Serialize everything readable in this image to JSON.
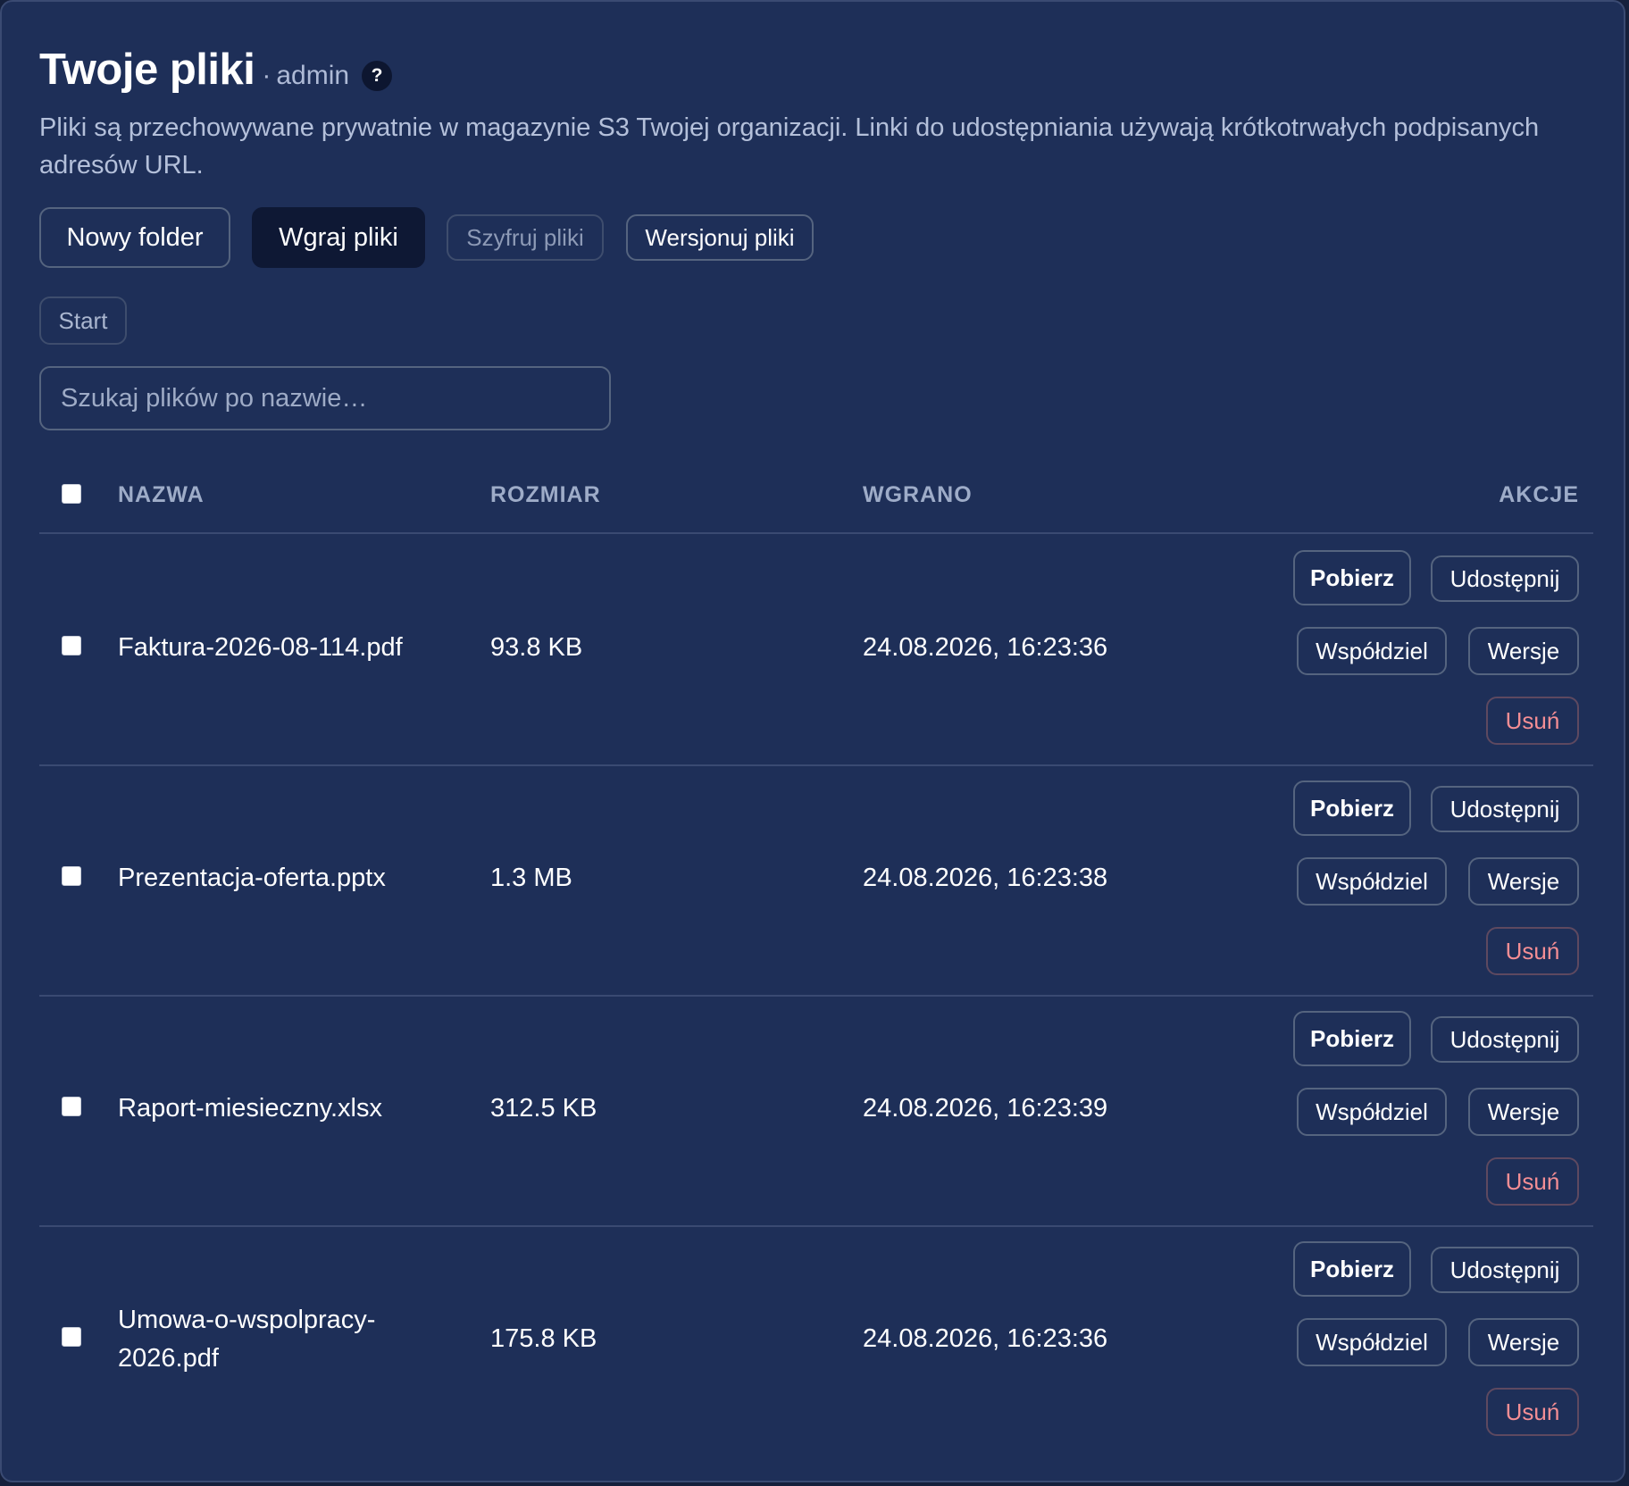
{
  "header": {
    "title": "Twoje pliki",
    "separator": "·",
    "user": "admin",
    "help_label": "?",
    "description": "Pliki są przechowywane prywatnie w magazynie S3 Twojej organizacji. Linki do udostępniania używają krótkotrwałych podpisanych adresów URL."
  },
  "toolbar": {
    "new_folder": "Nowy folder",
    "upload": "Wgraj pliki",
    "encrypt": "Szyfruj pliki",
    "version": "Wersjonuj pliki"
  },
  "breadcrumb": {
    "root": "Start"
  },
  "search": {
    "placeholder": "Szukaj plików po nazwie…",
    "value": ""
  },
  "table": {
    "headers": {
      "name": "NAZWA",
      "size": "ROZMIAR",
      "uploaded": "WGRANO",
      "actions": "AKCJE"
    },
    "actions": {
      "download": "Pobierz",
      "share": "Udostępnij",
      "coshare": "Współdziel",
      "versions": "Wersje",
      "delete": "Usuń"
    },
    "rows": [
      {
        "name": "Faktura-2026-08-114.pdf",
        "size": "93.8 KB",
        "uploaded": "24.08.2026, 16:23:36"
      },
      {
        "name": "Prezentacja-oferta.pptx",
        "size": "1.3 MB",
        "uploaded": "24.08.2026, 16:23:38"
      },
      {
        "name": "Raport-miesieczny.xlsx",
        "size": "312.5 KB",
        "uploaded": "24.08.2026, 16:23:39"
      },
      {
        "name": "Umowa-o-wspolpracy-2026.pdf",
        "size": "175.8 KB",
        "uploaded": "24.08.2026, 16:23:36"
      }
    ]
  },
  "colors": {
    "page_background": "#15203c",
    "panel": "#1e2f58",
    "primary_button": "#0e1834",
    "danger_text": "#f48e94",
    "muted_text": "#b4c0da"
  }
}
